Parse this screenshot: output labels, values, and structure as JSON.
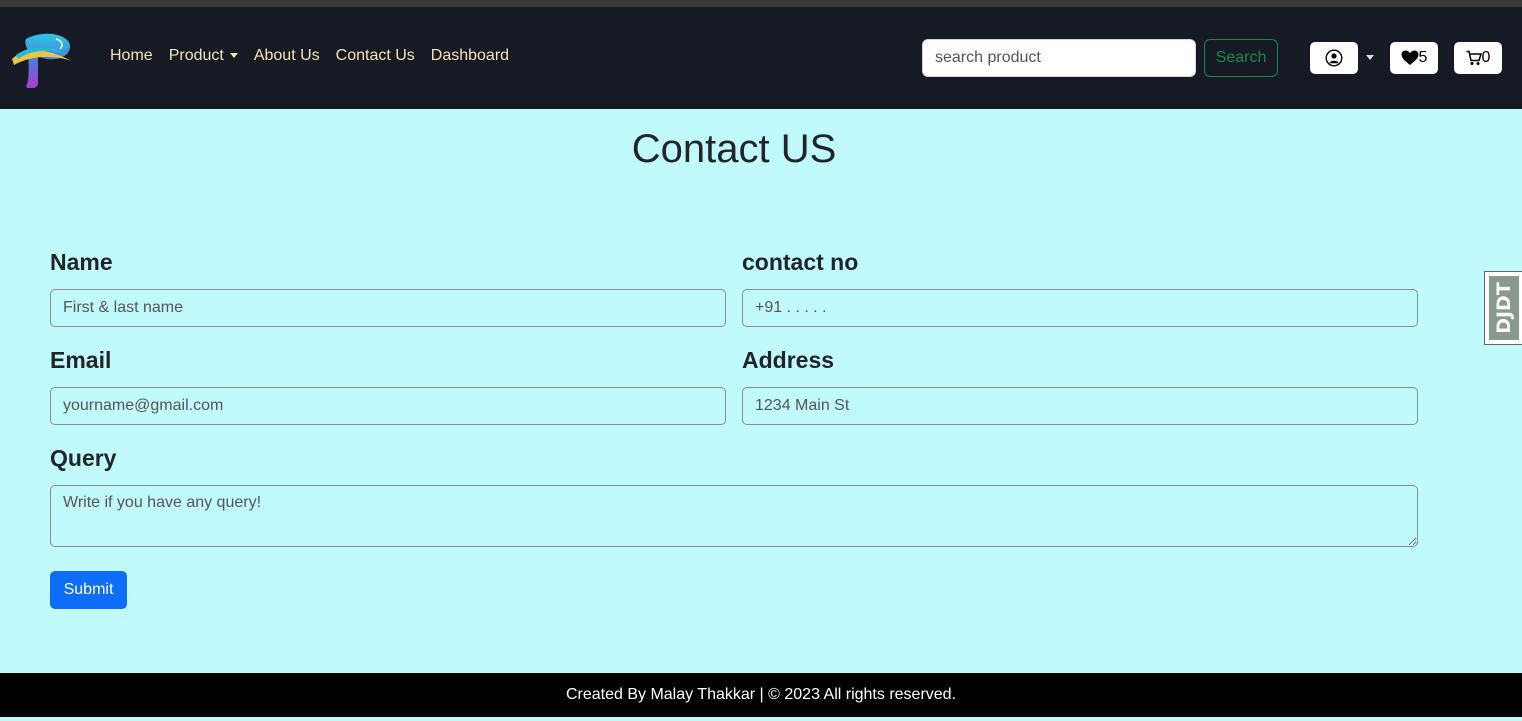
{
  "nav": {
    "links": [
      {
        "label": "Home"
      },
      {
        "label": "Product",
        "has_dropdown": true
      },
      {
        "label": "About Us"
      },
      {
        "label": "Contact Us"
      },
      {
        "label": "Dashboard"
      }
    ],
    "search_placeholder": "search product",
    "search_button": "Search",
    "wishlist_count": "5",
    "cart_count": "0"
  },
  "main": {
    "title": "Contact US",
    "form": {
      "name_label": "Name",
      "name_placeholder": "First & last name",
      "contact_label": "contact no",
      "contact_placeholder": "+91 . . . . .",
      "email_label": "Email",
      "email_placeholder": "yourname@gmail.com",
      "address_label": "Address",
      "address_placeholder": "1234 Main St",
      "query_label": "Query",
      "query_placeholder": "Write if you have any query!",
      "submit_label": "Submit"
    }
  },
  "debug_toolbar": {
    "label": "DJDT"
  },
  "footer": {
    "text": "Created By Malay Thakkar | © 2023 All rights reserved."
  },
  "colors": {
    "navbar_bg": "#151a24",
    "nav_link": "#f4e3b5",
    "page_bg": "#c0fafd",
    "primary": "#0d6efd",
    "success": "#198754",
    "footer_bg": "#000000"
  },
  "icons": [
    "logo-p-icon",
    "user-circle-icon",
    "heart-icon",
    "cart-icon",
    "chevron-down-icon"
  ]
}
